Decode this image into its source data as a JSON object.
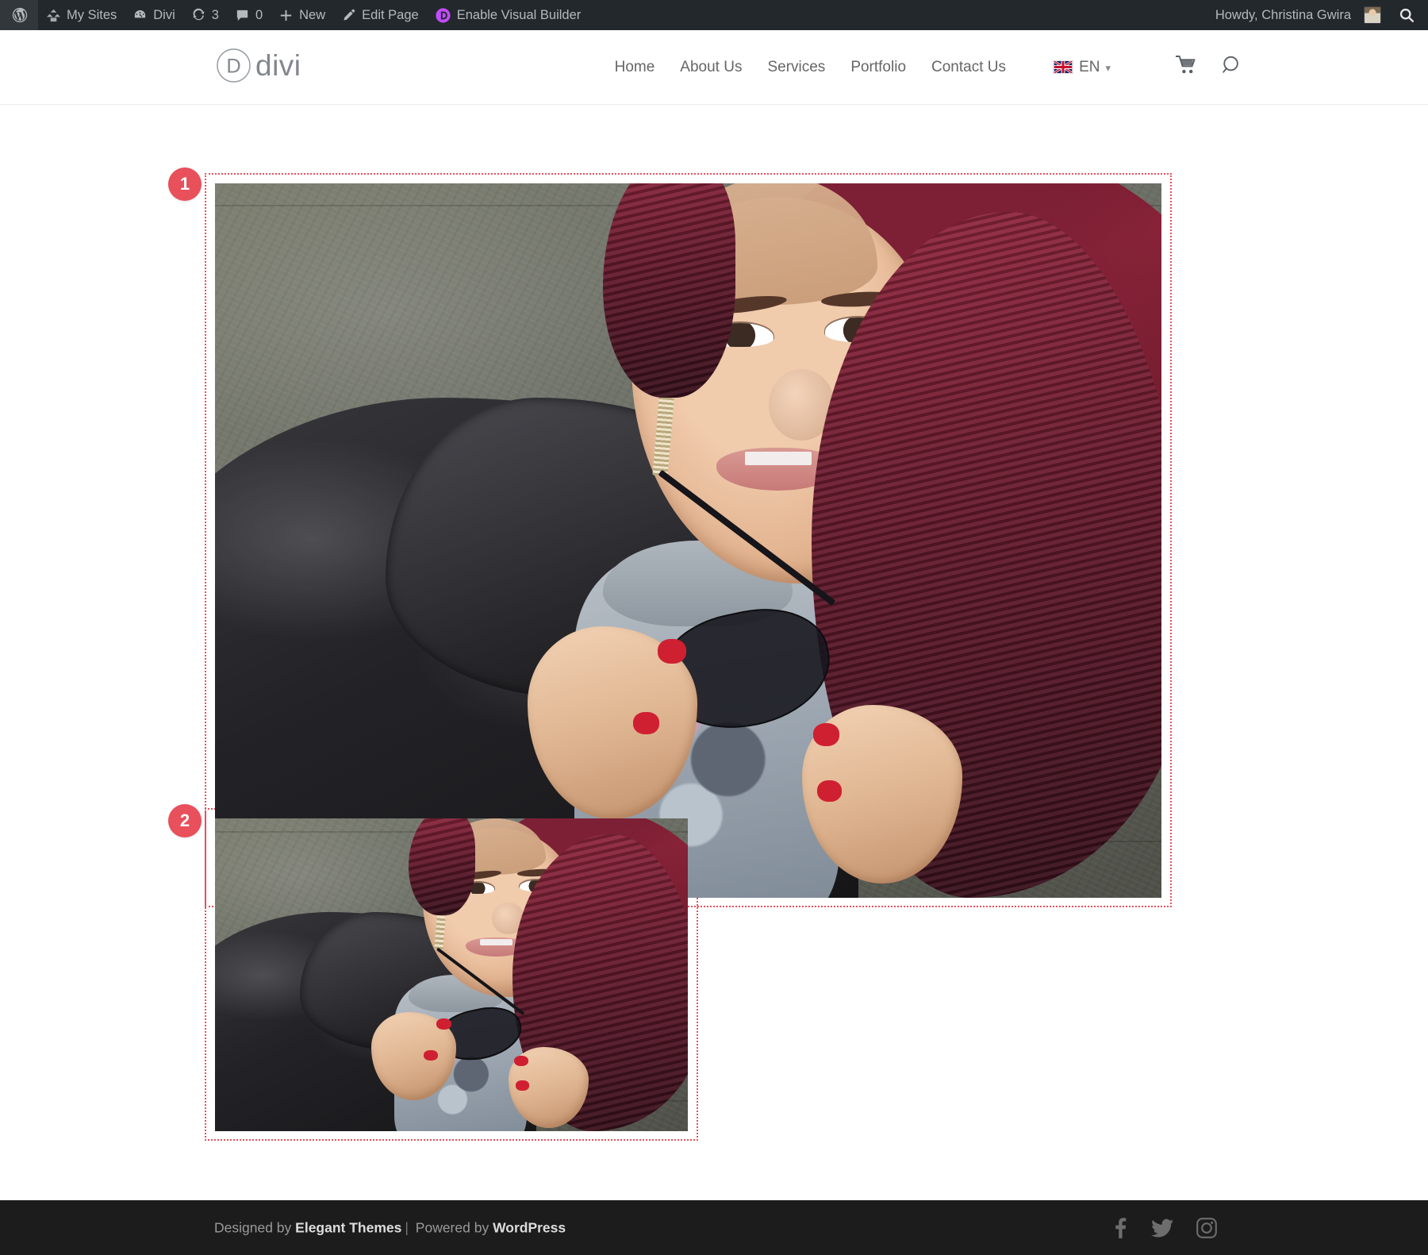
{
  "admin_bar": {
    "wp_logo_icon": "wordpress-logo-icon",
    "items": [
      {
        "icon": "my-sites-icon",
        "label": "My Sites",
        "count": ""
      },
      {
        "icon": "divi-dashboard-icon",
        "label": "Divi",
        "count": ""
      },
      {
        "icon": "updates-icon",
        "label": "",
        "count": "3"
      },
      {
        "icon": "comments-icon",
        "label": "",
        "count": "0"
      },
      {
        "icon": "plus-icon",
        "label": "New",
        "count": ""
      },
      {
        "icon": "pencil-icon",
        "label": "Edit Page",
        "count": ""
      },
      {
        "icon": "divi-builder-icon",
        "label": "Enable Visual Builder",
        "count": ""
      }
    ],
    "greeting": "Howdy, Christina Gwira",
    "avatar_icon": "user-avatar",
    "search_icon": "search-icon",
    "background": "#23282d",
    "text_color": "#b4b9be",
    "builder_accent": "#c44bff"
  },
  "header": {
    "logo_text": "divi",
    "logo_mark_letter": "D",
    "nav": [
      {
        "label": "Home"
      },
      {
        "label": "About Us"
      },
      {
        "label": "Services"
      },
      {
        "label": "Portfolio"
      },
      {
        "label": "Contact Us"
      }
    ],
    "language": {
      "code": "EN",
      "flag_icon": "uk-flag-icon",
      "chevron_icon": "chevron-down-icon"
    },
    "cart_icon": "shopping-cart-icon",
    "search_icon": "search-icon"
  },
  "builder": {
    "accent_color": "#e8505b",
    "modules": [
      {
        "marker": "1",
        "name": "image-module-large",
        "alt": "Woman with burgundy hair in leather jacket holding sunglasses"
      },
      {
        "marker": "2",
        "name": "image-module-small",
        "alt": "Woman with burgundy hair in leather jacket holding sunglasses"
      }
    ]
  },
  "footer": {
    "credit_prefix": "Designed by ",
    "credit_brand": "Elegant Themes",
    "credit_separator": "|",
    "credit_middle": " Powered by ",
    "credit_platform": "WordPress",
    "social": [
      {
        "icon": "facebook-icon",
        "label": "Facebook"
      },
      {
        "icon": "twitter-icon",
        "label": "Twitter"
      },
      {
        "icon": "instagram-icon",
        "label": "Instagram"
      }
    ],
    "background": "#1c1c1c"
  }
}
